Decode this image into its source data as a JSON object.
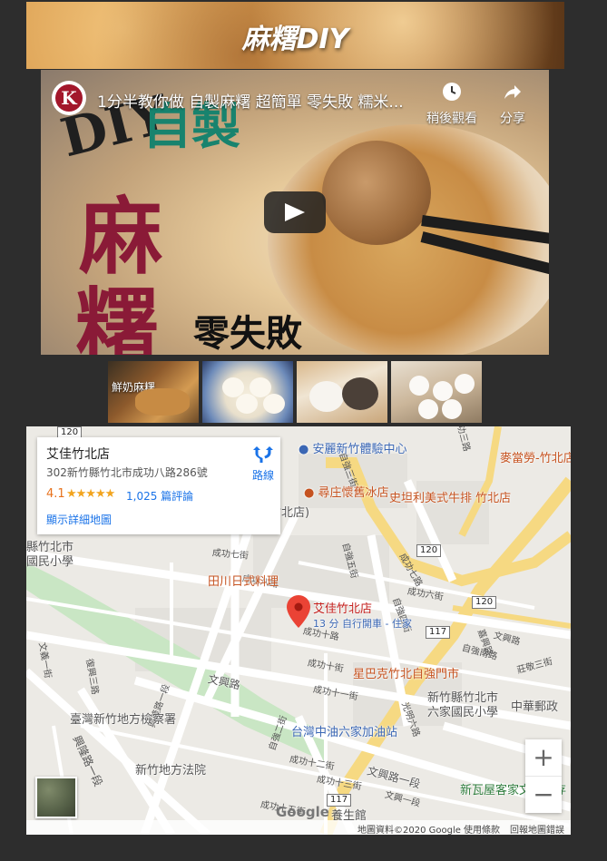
{
  "header": {
    "title": "麻糬DIY"
  },
  "video": {
    "title": "1分半教你做 自製麻糬 超簡單 零失敗 糯米...",
    "channel_initial": "K",
    "watch_later": "稍後觀看",
    "share": "分享",
    "thumb_diy": "DIY",
    "thumb_self": "自製",
    "thumb_ma": "麻",
    "thumb_ji": "糬",
    "thumb_zero": "零失敗"
  },
  "thumbnails": [
    {
      "caption": "鮮奶麻糬"
    },
    {
      "caption": ""
    },
    {
      "caption": ""
    },
    {
      "caption": ""
    }
  ],
  "map": {
    "info": {
      "name": "艾佳竹北店",
      "address": "302新竹縣竹北市成功八路286號",
      "rating": "4.1",
      "stars": "★★★★★",
      "reviews": "1,025 篇評論",
      "view_larger": "顯示詳細地圖",
      "directions": "路線"
    },
    "pin": {
      "name": "艾佳竹北店",
      "sub": "13 分 自行開車 - 住家"
    },
    "pois": [
      {
        "label": "安麗新竹體驗中心",
        "color": "blue"
      },
      {
        "label": "麥當勞-竹北店",
        "color": "orange"
      },
      {
        "label": "尋庄懷舊冰店",
        "color": "orange"
      },
      {
        "label": "史坦利美式牛排 竹北店",
        "color": "orange"
      },
      {
        "label": "竹北店)",
        "color": "gray"
      },
      {
        "label": "田川日式料理",
        "color": "orange"
      },
      {
        "label": "星巴克竹北自強門市",
        "color": "orange"
      },
      {
        "label": "新竹縣竹北市",
        "color": "gray"
      },
      {
        "label": "六家國民小學",
        "color": "gray"
      },
      {
        "label": "中華郵政",
        "color": "gray"
      },
      {
        "label": "台灣中油六家加油站",
        "color": "blue"
      },
      {
        "label": "臺灣新竹地方檢察署",
        "color": "gray"
      },
      {
        "label": "新竹地方法院",
        "color": "gray"
      },
      {
        "label": "新瓦屋客家文化保存",
        "color": "green"
      },
      {
        "label": "縣竹北市",
        "color": "gray"
      },
      {
        "label": "國民小學",
        "color": "gray"
      },
      {
        "label": "養生館",
        "color": "gray"
      }
    ],
    "roads": [
      "成功七街",
      "成功八路",
      "成功十街",
      "成功十一街",
      "成功十二街",
      "成功十三街",
      "成功十五街",
      "成功六街",
      "文興路",
      "文興路一段",
      "興隆路一段",
      "自強三街",
      "自強二街",
      "自強五街",
      "嘉興路",
      "成功三路",
      "文興路",
      "成功七路",
      "光明六路",
      "成功十路",
      "復興三路",
      "文義一街",
      "興隆路一段",
      "自強四街",
      "莊敬三街",
      "自強南路",
      "文興一段"
    ],
    "shields": [
      "120",
      "120",
      "120",
      "117",
      "117"
    ],
    "footer": {
      "attribution": "地圖資料©2020 Google",
      "terms": "使用條款",
      "report": "回報地圖錯誤"
    },
    "google_logo": "Google"
  }
}
